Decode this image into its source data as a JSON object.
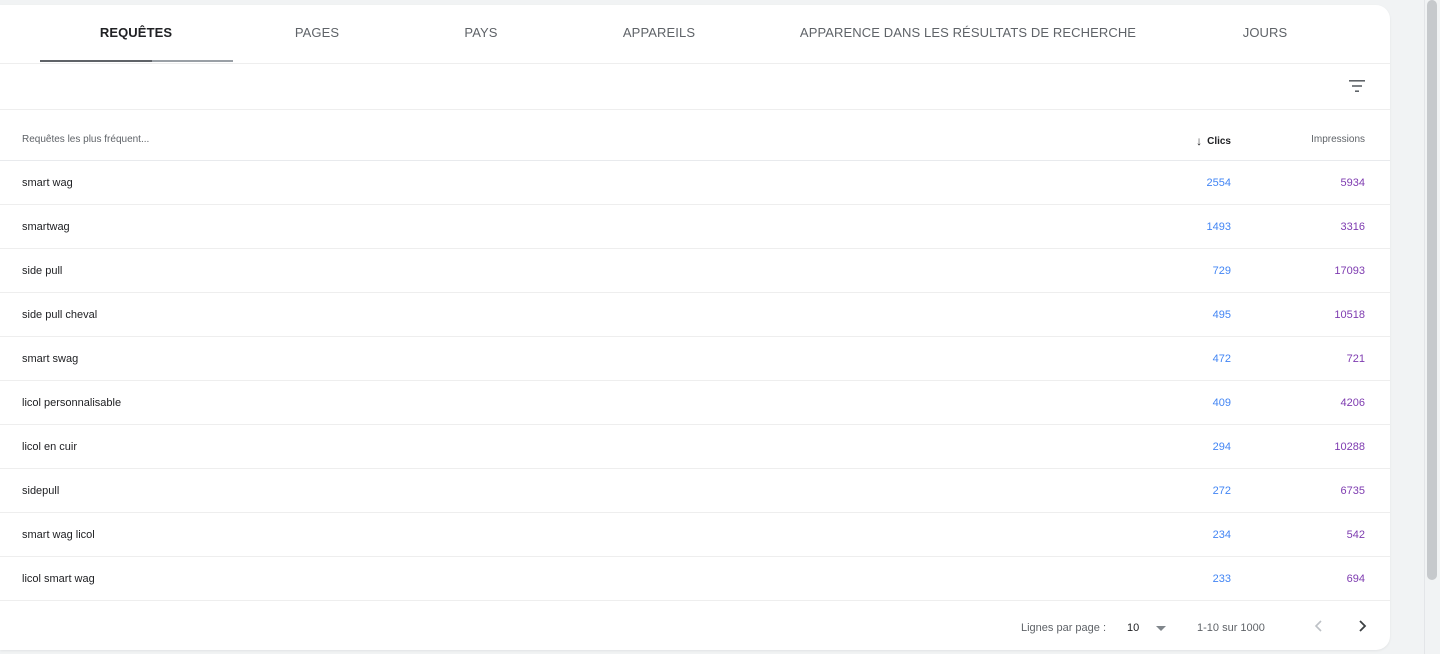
{
  "tabs": [
    {
      "label": "REQUÊTES",
      "active": true
    },
    {
      "label": "PAGES",
      "active": false
    },
    {
      "label": "PAYS",
      "active": false
    },
    {
      "label": "APPAREILS",
      "active": false
    },
    {
      "label": "APPARENCE DANS LES RÉSULTATS DE RECHERCHE",
      "active": false
    },
    {
      "label": "JOURS",
      "active": false
    }
  ],
  "filter": {
    "icon": "filter-icon"
  },
  "table": {
    "headers": {
      "query": "Requêtes les plus fréquent...",
      "clicks": "Clics",
      "clicks_sort_icon": "arrow-down-icon",
      "impressions": "Impressions"
    },
    "rows": [
      {
        "query": "smart wag",
        "clicks": "2554",
        "impressions": "5934"
      },
      {
        "query": "smartwag",
        "clicks": "1493",
        "impressions": "3316"
      },
      {
        "query": "side pull",
        "clicks": "729",
        "impressions": "17093"
      },
      {
        "query": "side pull cheval",
        "clicks": "495",
        "impressions": "10518"
      },
      {
        "query": "smart swag",
        "clicks": "472",
        "impressions": "721"
      },
      {
        "query": "licol personnalisable",
        "clicks": "409",
        "impressions": "4206"
      },
      {
        "query": "licol en cuir",
        "clicks": "294",
        "impressions": "10288"
      },
      {
        "query": "sidepull",
        "clicks": "272",
        "impressions": "6735"
      },
      {
        "query": "smart wag licol",
        "clicks": "234",
        "impressions": "542"
      },
      {
        "query": "licol smart wag",
        "clicks": "233",
        "impressions": "694"
      }
    ]
  },
  "pagination": {
    "rows_per_page_label": "Lignes par page :",
    "rows_per_page_value": "10",
    "range": "1-10 sur 1000",
    "prev_icon": "chevron-left-icon",
    "next_icon": "chevron-right-icon"
  },
  "colors": {
    "clicks": "#4285f4",
    "impressions": "#7e3bb0",
    "text": "#202124",
    "muted": "#5f6368"
  }
}
